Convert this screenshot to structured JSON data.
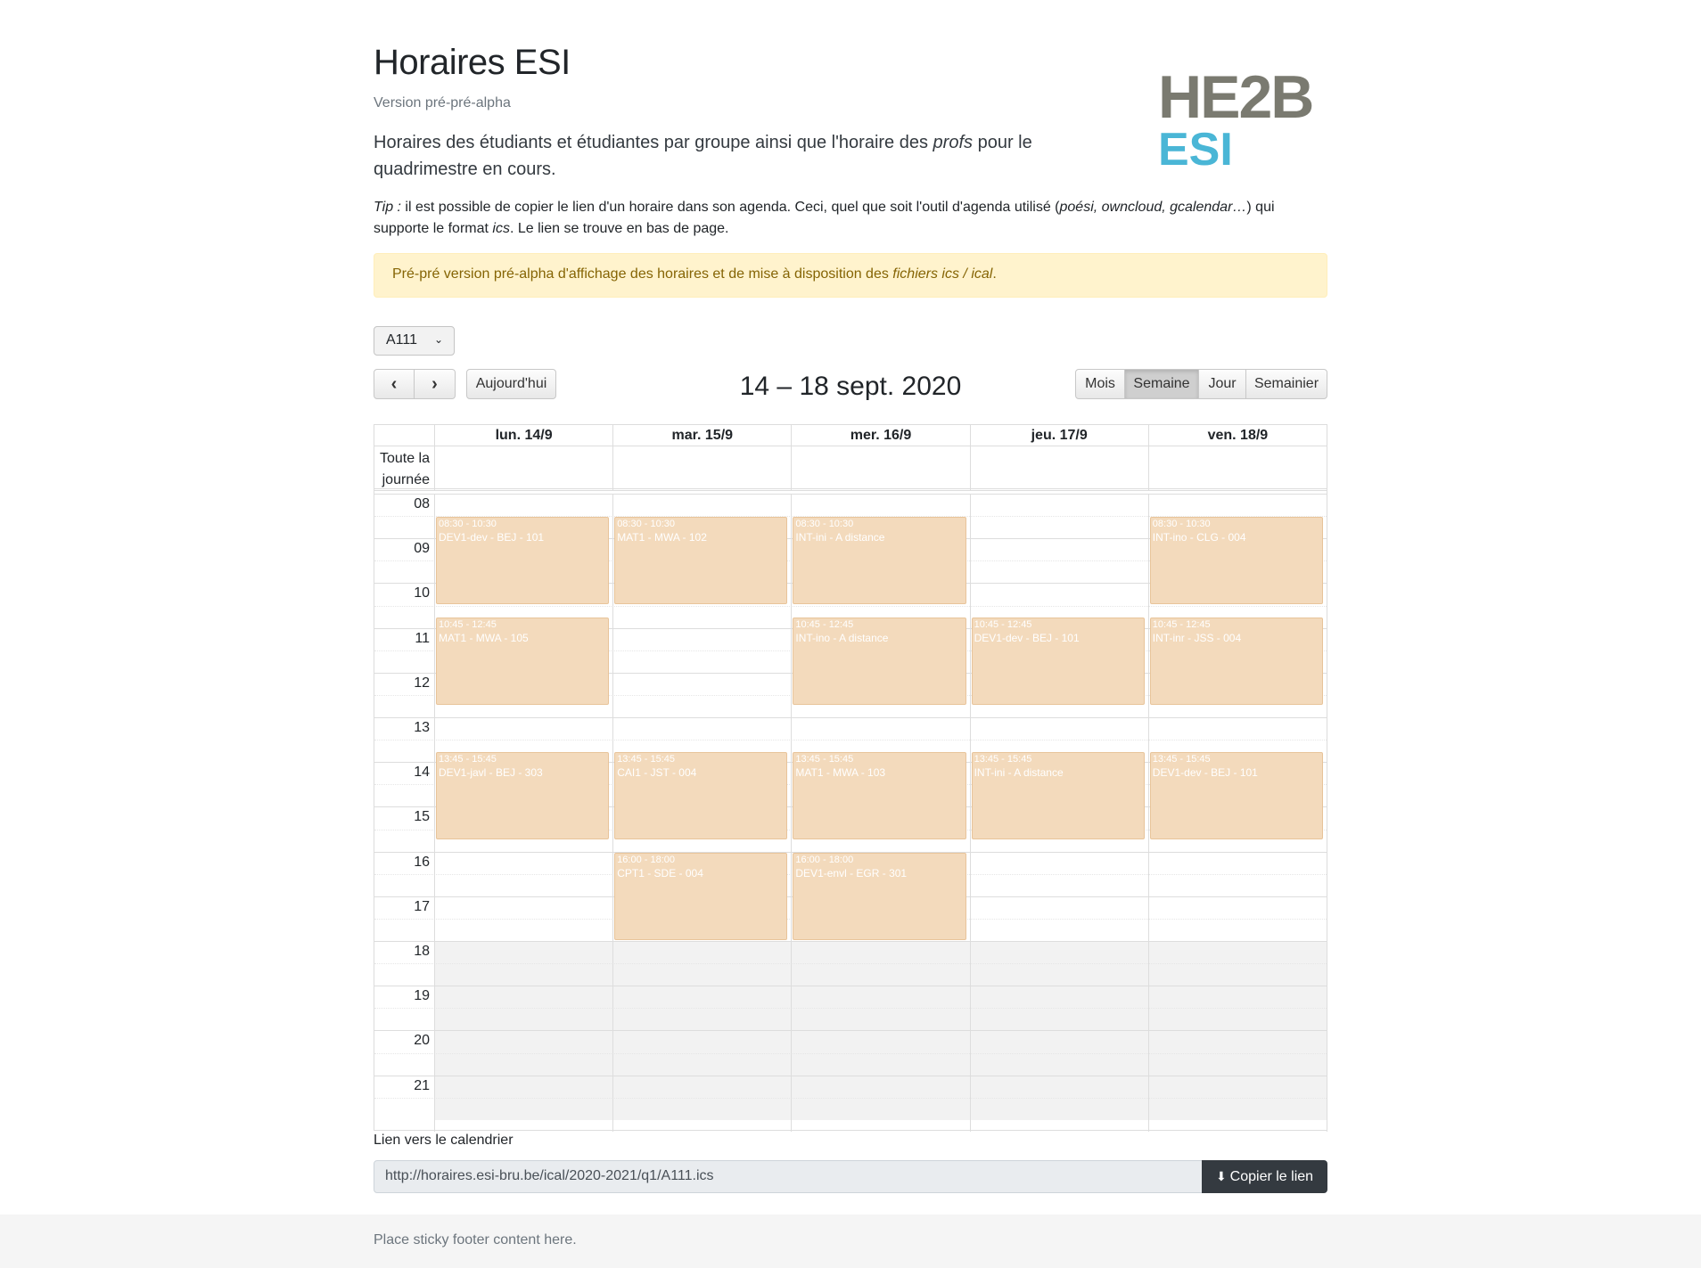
{
  "header": {
    "title": "Horaires ESI",
    "version": "Version pré-pré-alpha",
    "lead_a": "Horaires des étudiants et étudiantes par groupe ainsi que l'horaire des ",
    "lead_em": "profs",
    "lead_b": " pour le quadrimestre en cours.",
    "tip_em": "Tip :",
    "tip_a": " il est possible de copier le lien d'un horaire dans son agenda. Ceci, quel que soit l'outil d'agenda utilisé (",
    "tip_tools": "poési, owncloud, gcalendar…",
    "tip_b": ") qui supporte le format ",
    "tip_ics": "ics",
    "tip_c": ". Le lien se trouve en bas de page.",
    "logo_he": "HE2B",
    "logo_esi": "ESI"
  },
  "alert": {
    "text": "Pré-pré version pré-alpha d'affichage des horaires et de mise à disposition des ",
    "em": "fichiers ics / ical",
    "end": "."
  },
  "group_select": {
    "value": "A111"
  },
  "toolbar": {
    "prev": "‹",
    "next": "›",
    "today": "Aujourd'hui",
    "title": "14 – 18 sept. 2020",
    "views": [
      "Mois",
      "Semaine",
      "Jour",
      "Semainier"
    ],
    "active_view": "Semaine"
  },
  "calendar": {
    "days": [
      "lun. 14/9",
      "mar. 15/9",
      "mer. 16/9",
      "jeu. 17/9",
      "ven. 18/9"
    ],
    "allday_label": "Toute la journée",
    "hours": [
      "08",
      "09",
      "10",
      "11",
      "12",
      "13",
      "14",
      "15",
      "16",
      "17",
      "18",
      "19",
      "20",
      "21"
    ],
    "business_end": "18",
    "events": [
      {
        "day": 0,
        "start": "08:30",
        "end": "10:30",
        "time": "08:30 - 10:30",
        "title": "DEV1-dev - BEJ - 101"
      },
      {
        "day": 1,
        "start": "08:30",
        "end": "10:30",
        "time": "08:30 - 10:30",
        "title": "MAT1 - MWA - 102"
      },
      {
        "day": 2,
        "start": "08:30",
        "end": "10:30",
        "time": "08:30 - 10:30",
        "title": "INT-ini - A distance"
      },
      {
        "day": 4,
        "start": "08:30",
        "end": "10:30",
        "time": "08:30 - 10:30",
        "title": "INT-ino - CLG - 004"
      },
      {
        "day": 0,
        "start": "10:45",
        "end": "12:45",
        "time": "10:45 - 12:45",
        "title": "MAT1 - MWA - 105"
      },
      {
        "day": 2,
        "start": "10:45",
        "end": "12:45",
        "time": "10:45 - 12:45",
        "title": "INT-ino - A distance"
      },
      {
        "day": 3,
        "start": "10:45",
        "end": "12:45",
        "time": "10:45 - 12:45",
        "title": "DEV1-dev - BEJ - 101"
      },
      {
        "day": 4,
        "start": "10:45",
        "end": "12:45",
        "time": "10:45 - 12:45",
        "title": "INT-inr - JSS - 004"
      },
      {
        "day": 0,
        "start": "13:45",
        "end": "15:45",
        "time": "13:45 - 15:45",
        "title": "DEV1-javl - BEJ - 303"
      },
      {
        "day": 1,
        "start": "13:45",
        "end": "15:45",
        "time": "13:45 - 15:45",
        "title": "CAI1 - JST - 004"
      },
      {
        "day": 2,
        "start": "13:45",
        "end": "15:45",
        "time": "13:45 - 15:45",
        "title": "MAT1 - MWA - 103"
      },
      {
        "day": 3,
        "start": "13:45",
        "end": "15:45",
        "time": "13:45 - 15:45",
        "title": "INT-ini - A distance"
      },
      {
        "day": 4,
        "start": "13:45",
        "end": "15:45",
        "time": "13:45 - 15:45",
        "title": "DEV1-dev - BEJ - 101"
      },
      {
        "day": 1,
        "start": "16:00",
        "end": "18:00",
        "time": "16:00 - 18:00",
        "title": "CPT1 - SDE - 004"
      },
      {
        "day": 2,
        "start": "16:00",
        "end": "18:00",
        "time": "16:00 - 18:00",
        "title": "DEV1-envl - EGR - 301"
      }
    ]
  },
  "link": {
    "label": "Lien vers le calendrier",
    "url": "http://horaires.esi-bru.be/ical/2020-2021/q1/A111.ics",
    "copy_label": "Copier le lien",
    "copy_icon": "download-icon"
  },
  "footer": {
    "text": "Place sticky footer content here."
  },
  "colors": {
    "event_bg": "#f3dabc",
    "alert_bg": "#fff3cd",
    "copy_btn": "#343a40",
    "logo_grey": "#7a7a70",
    "logo_blue": "#4ab6d6"
  }
}
